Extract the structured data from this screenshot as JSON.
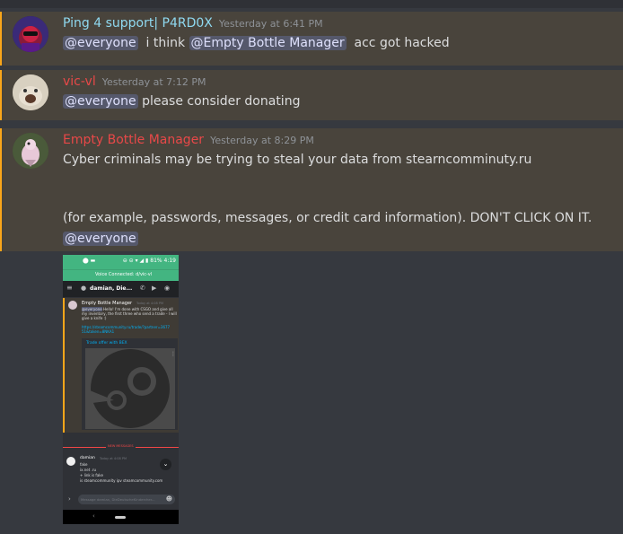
{
  "messages": [
    {
      "author": "Ping 4 support| P4RD0X",
      "author_color": "#8fd9f0",
      "timestamp": "Yesterday at 6:41 PM",
      "mention_1": "@everyone",
      "text_1": "i think",
      "mention_2": "@Empty Bottle Manager",
      "text_2": "acc got hacked"
    },
    {
      "author": "vic-vl",
      "author_color": "#e84848",
      "timestamp": "Yesterday at 7:12 PM",
      "mention_1": "@everyone",
      "text_1": "please consider donating"
    },
    {
      "author": "Empty Bottle Manager",
      "author_color": "#e84848",
      "timestamp": "Yesterday at 8:29 PM",
      "line_1": "Cyber criminals may be trying to steal your data from stearncomminuty.ru",
      "line_2": "(for example, passwords, messages, or credit card information). DON'T CLICK ON IT.",
      "mention_1": "@everyone"
    }
  ],
  "attachment": {
    "status_bar": "⊖ ⊝ ▾ ◢ ▮ 81% 4:19",
    "voice_banner": "Voice Connected: d/vic-vl",
    "header": "damian, Die...",
    "inner_author": "Empty Bottle Manager",
    "inner_ts": "Today at 4:08 PM",
    "inner_mention": "@everyone",
    "inner_text": "Hello! I'm done with CSGO and give all my inventory, the first three who send a trade - I will give a knife :)",
    "inner_link": "https://steamcommunity.ru/trade/?partner=367751&token=8NKA1",
    "trade_title": "Trade offer with ВЕХ",
    "new_messages": "NEW MESSAGES",
    "reply_author": "damian",
    "reply_ts": "Today at 4:08 PM",
    "reply_lines": [
      "fake",
      "ix.net .ru",
      "+ link is fake",
      "is steamcommunity ipv steamcommunity.com"
    ],
    "input_placeholder": "Message damian, DieDeutscheKindercher..."
  }
}
